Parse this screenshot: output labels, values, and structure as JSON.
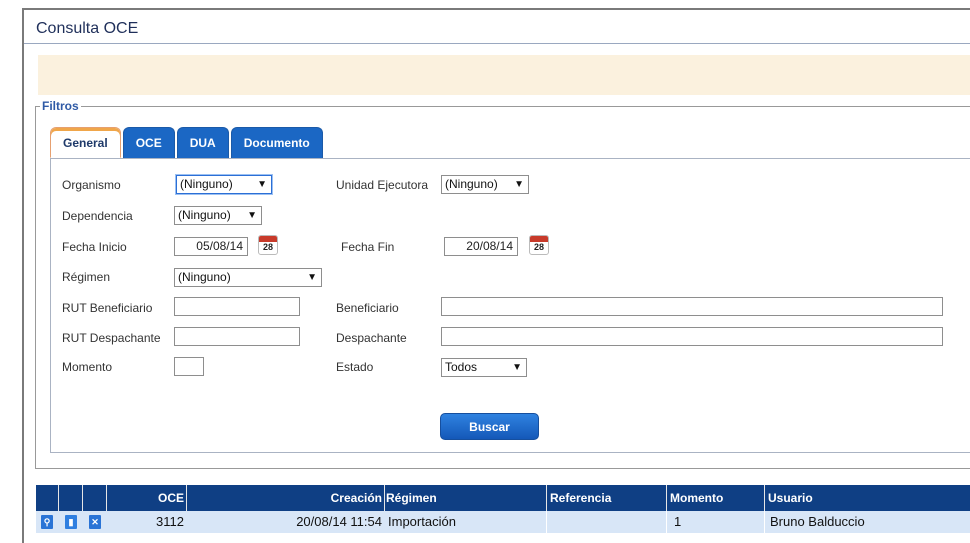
{
  "page": {
    "title": "Consulta OCE"
  },
  "filters": {
    "legend": "Filtros",
    "tabs": [
      {
        "label": "General",
        "active": true
      },
      {
        "label": "OCE",
        "active": false
      },
      {
        "label": "DUA",
        "active": false
      },
      {
        "label": "Documento",
        "active": false
      }
    ],
    "fields": {
      "organismo_label": "Organismo",
      "organismo_value": "(Ninguno)",
      "unidad_ejecutora_label": "Unidad Ejecutora",
      "unidad_ejecutora_value": "(Ninguno)",
      "dependencia_label": "Dependencia",
      "dependencia_value": "(Ninguno)",
      "fecha_inicio_label": "Fecha Inicio",
      "fecha_inicio_value": "05/08/14",
      "fecha_fin_label": "Fecha Fin",
      "fecha_fin_value": "20/08/14",
      "calendar_day": "28",
      "regimen_label": "Régimen",
      "regimen_value": "(Ninguno)",
      "rut_beneficiario_label": "RUT Beneficiario",
      "rut_beneficiario_value": "",
      "beneficiario_label": "Beneficiario",
      "beneficiario_value": "",
      "rut_despachante_label": "RUT Despachante",
      "rut_despachante_value": "",
      "despachante_label": "Despachante",
      "despachante_value": "",
      "momento_label": "Momento",
      "momento_value": "",
      "estado_label": "Estado",
      "estado_value": "Todos"
    },
    "search_button": "Buscar"
  },
  "grid": {
    "columns": [
      "OCE",
      "Creación",
      "Régimen",
      "Referencia",
      "Momento",
      "Usuario"
    ],
    "rows": [
      {
        "oce": "3112",
        "creacion": "20/08/14 11:54",
        "regimen": "Importación",
        "referencia": "",
        "momento": "1",
        "usuario": "Bruno Balduccio"
      }
    ],
    "row_icons": [
      "view-icon",
      "document-icon",
      "delete-icon"
    ]
  },
  "colors": {
    "tab_blue": "#1b67c4",
    "grid_header": "#0f3f84",
    "notice_bar": "#fbf1de",
    "legend_text": "#2f5aa6"
  }
}
